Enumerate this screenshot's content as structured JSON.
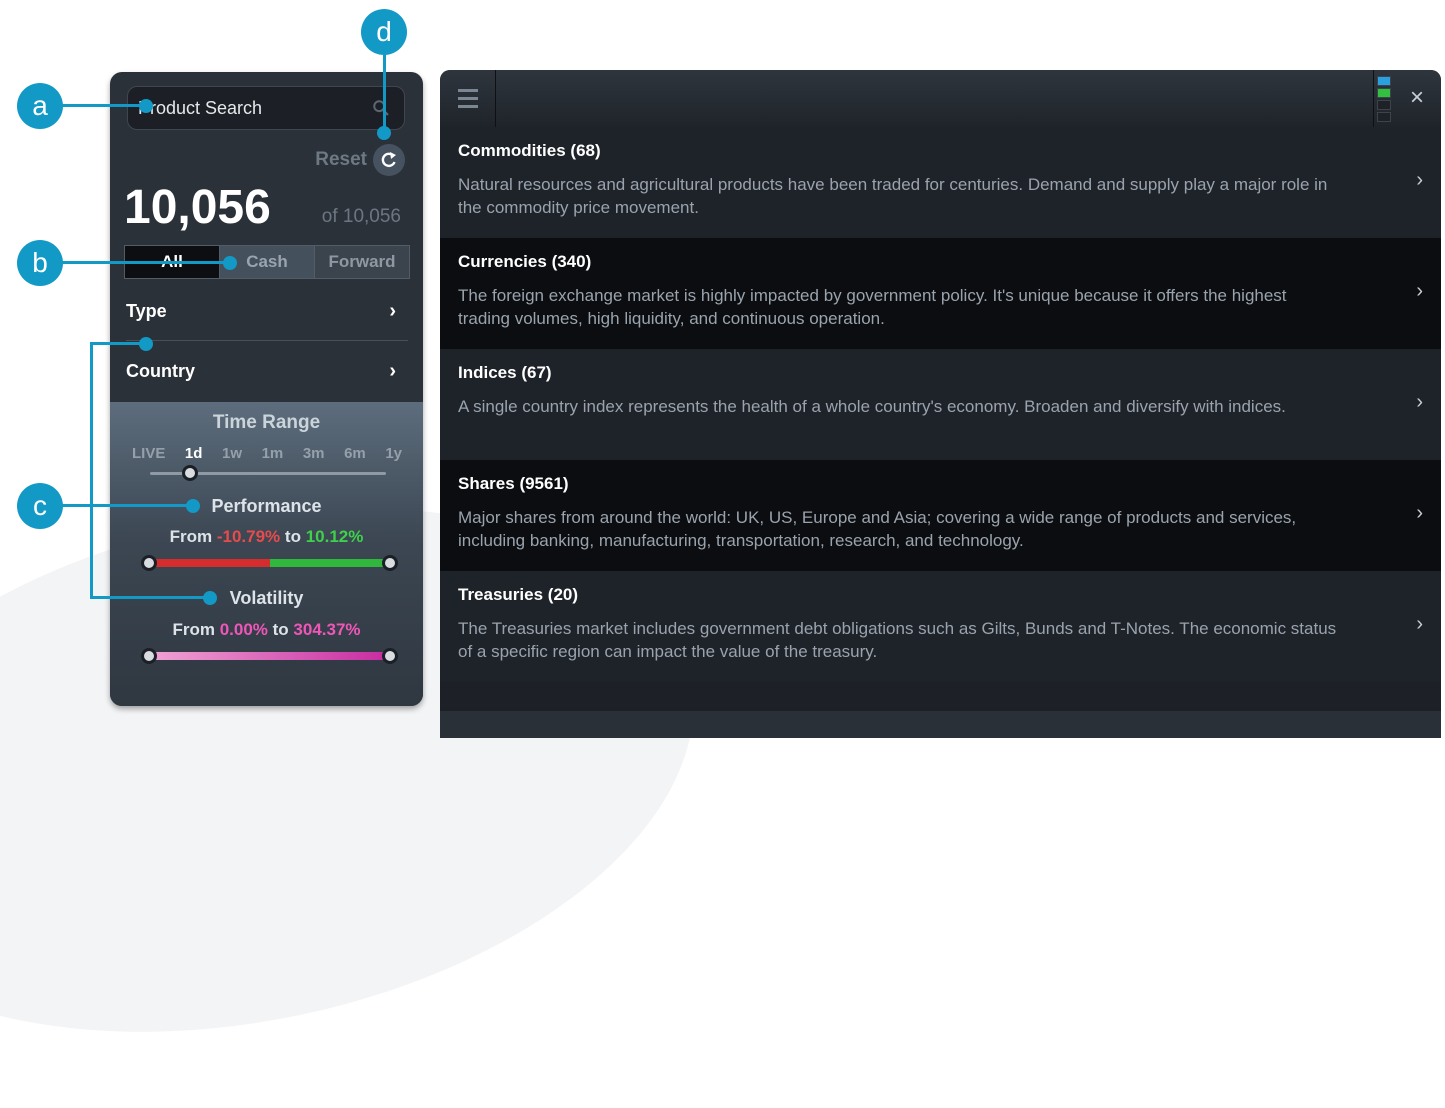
{
  "callouts": {
    "a": "a",
    "b": "b",
    "c": "c",
    "d": "d"
  },
  "search": {
    "placeholder": "Product Search"
  },
  "reset": {
    "label": "Reset"
  },
  "count": {
    "value": "10,056",
    "of": "of 10,056"
  },
  "product_tabs": [
    "All",
    "Cash",
    "Forward"
  ],
  "filters": {
    "type": "Type",
    "country": "Country",
    "chevron": "›"
  },
  "time_range": {
    "title": "Time Range",
    "options": [
      "LIVE",
      "1d",
      "1w",
      "1m",
      "3m",
      "6m",
      "1y"
    ],
    "selected": "1d"
  },
  "performance": {
    "title": "Performance",
    "from_label": "From",
    "from": "-10.79%",
    "to_label": "to",
    "to": "10.12%"
  },
  "volatility": {
    "title": "Volatility",
    "from_label": "From",
    "from": "0.00%",
    "to_label": "to",
    "to": "304.37%"
  },
  "categories": [
    {
      "name": "Commodities",
      "count": "(68)",
      "desc": "Natural resources and agricultural products have been traded for centuries. Demand and supply play a major role in the commodity price movement."
    },
    {
      "name": "Currencies",
      "count": "(340)",
      "desc": "The foreign exchange market is highly impacted by government policy. It's unique because it offers the highest trading volumes, high liquidity, and continuous operation."
    },
    {
      "name": "Indices",
      "count": "(67)",
      "desc": "A single country index represents the health of a whole country's economy. Broaden and diversify with indices."
    },
    {
      "name": "Shares",
      "count": "(9561)",
      "desc": "Major shares from around the world: UK, US, Europe and Asia; covering a wide range of products and services, including banking, manufacturing, transportation, research, and technology."
    },
    {
      "name": "Treasuries",
      "count": "(20)",
      "desc": "The Treasuries market includes government debt obligations such as Gilts, Bunds and T-Notes. The economic status of a specific region can impact the value of the treasury."
    }
  ],
  "header": {
    "close": "×"
  },
  "colors": {
    "accent": "#1299c6",
    "negative": "#e84b4b",
    "positive": "#3ed14a",
    "volatility": "#ef56b8"
  },
  "icons": [
    "search-icon",
    "reset-icon",
    "menu-icon",
    "signal-icon",
    "close-icon",
    "chevron-right-icon"
  ]
}
